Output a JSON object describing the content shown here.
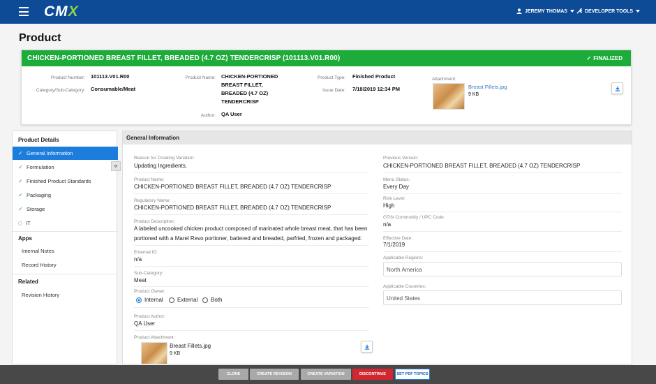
{
  "app": {
    "logo_main": "CM",
    "logo_accent": "X",
    "user_name": "JEREMY THOMAS",
    "tools_label": "DEVELOPER TOOLS"
  },
  "page": {
    "title": "Product"
  },
  "product": {
    "banner_title": "CHICKEN-PORTIONED BREAST FILLET, BREADED (4.7 OZ) TENDERCRISP (101113.V01.R00)",
    "status": "FINALIZED",
    "status_color": "#1dab3a",
    "labels": {
      "number": "Product Number:",
      "category": "Category/Sub-Category:",
      "name": "Product Name:",
      "author": "Author:",
      "type": "Product Type:",
      "issue_date": "Issue Date:",
      "attachment": "Attachment:"
    },
    "values": {
      "number": "101113.V01.R00",
      "category": "Consumable/Meat",
      "name_lines": [
        "CHICKEN-PORTIONED",
        "BREAST FILLET,",
        "BREADED (4.7 OZ)",
        "TENDERCRISP"
      ],
      "author": "QA User",
      "type": "Finished Product",
      "issue_date": "7/18/2019 12:34 PM",
      "attachment_name": "Breast Fillets.jpg",
      "attachment_size": "9 KB"
    }
  },
  "sidebar": {
    "details_heading": "Product Details",
    "details_items": [
      {
        "label": "General Information",
        "state": "check"
      },
      {
        "label": "Formulation",
        "state": "check"
      },
      {
        "label": "Finished Product Standards",
        "state": "check"
      },
      {
        "label": "Packaging",
        "state": "check"
      },
      {
        "label": "Storage",
        "state": "check"
      },
      {
        "label": "IT",
        "state": "empty"
      }
    ],
    "apps_heading": "Apps",
    "apps_items": [
      "Internal Notes",
      "Record History"
    ],
    "related_heading": "Related",
    "related_items": [
      "Revision History"
    ],
    "collapse_glyph": "«"
  },
  "general_info": {
    "heading": "General Information",
    "left": {
      "reason_label": "Reason for Creating Variation:",
      "reason_value": "Updating Ingredients.",
      "product_name_label": "Product Name:",
      "product_name_value": "CHICKEN-PORTIONED BREAST FILLET, BREADED (4.7 OZ) TENDERCRISP",
      "regulatory_label": "Regulatory Name:",
      "regulatory_value": "CHICKEN-PORTIONED BREAST FILLET, BREADED (4.7 OZ) TENDERCRISP",
      "description_label": "Product Description:",
      "description_line1": "A labeled uncooked chicken product composed of marinated whole breast meat, that has been",
      "description_line2": "portioned with a Marel Revo portioner, battered and breaded, parfried, frozen and packaged.",
      "external_label": "External ID:",
      "external_value": "n/a",
      "subcat_label": "Sub-Category:",
      "subcat_value": "Meat",
      "owner_label": "Product Owner:",
      "owner_options": [
        "Internal",
        "External",
        "Both"
      ],
      "owner_selected": "Internal",
      "author_label": "Product Author:",
      "author_value": "QA User",
      "attachment_label": "Product Attachment:",
      "attachment_name": "Breast Fillets.jpg",
      "attachment_size": "9 KB"
    },
    "right": {
      "prev_version_label": "Previous Version:",
      "prev_version_value": "CHICKEN-PORTIONED BREAST FILLET, BREADED (4.7 OZ) TENDERCRISP",
      "menu_status_label": "Menu Status:",
      "menu_status_value": "Every Day",
      "risk_label": "Risk Level:",
      "risk_value": "High",
      "gtin_label": "GTIN Commodity / UPC Code:",
      "gtin_value": "n/a",
      "effective_label": "Effective Date:",
      "effective_value": "7/1/2019",
      "regions_label": "Applicable Regions:",
      "regions_value": "North America",
      "countries_label": "Applicable Countries:",
      "countries_value": "United States"
    }
  },
  "actions": [
    {
      "label": "CLONE",
      "color": "#a9a9a9"
    },
    {
      "label": "CREATE REVISION",
      "color": "#a9a9a9"
    },
    {
      "label": "CREATE VARIATION",
      "color": "#a9a9a9"
    },
    {
      "label": "DISCONTINUE",
      "color": "#d22630"
    },
    {
      "label": "SET PDF TOPICS",
      "color": "#ffffff"
    }
  ],
  "colors": {
    "header": "#0d4b97",
    "accent": "#1d7ddc",
    "success": "#1dab3a",
    "link": "#3a78c8"
  }
}
